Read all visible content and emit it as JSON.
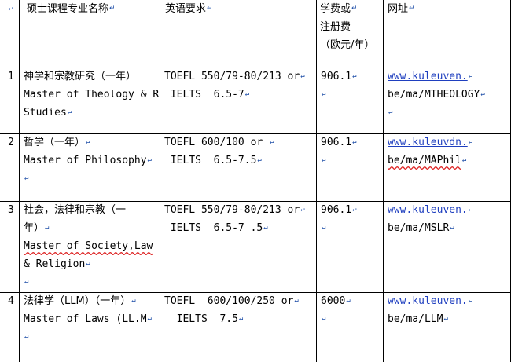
{
  "header": {
    "num": "",
    "program": "硕士课程专业名称",
    "english": "英语要求",
    "fee": [
      "学费或",
      "注册费",
      "（欧元/年）"
    ],
    "url": "网址"
  },
  "rows": [
    {
      "num": "1",
      "name_cn": "神学和宗教研究（一年）",
      "name_en": [
        "Master of Theology & Re",
        "Studies"
      ],
      "english": [
        "TOEFL 550/79-80/213 or",
        " IELTS  6.5-7"
      ],
      "fee": "906.1",
      "url": [
        "www.kuleuven.",
        "be/ma/MTHEOLOGY"
      ]
    },
    {
      "num": "2",
      "name_cn": "哲学（一年）",
      "name_en": [
        "Master of Philosophy"
      ],
      "english": [
        "TOEFL 600/100 or ",
        " IELTS  6.5-7.5"
      ],
      "fee": "906.1",
      "url": [
        "www.kuleuvdn.",
        "be/ma/MAPhil"
      ]
    },
    {
      "num": "3",
      "name_cn": [
        "社会，法律和宗教（一",
        "年）"
      ],
      "name_en": [
        "Master of Society,Law",
        "& Religion"
      ],
      "english": [
        "TOEFL 550/79-80/213 or",
        " IELTS  6.5-7 .5"
      ],
      "fee": "906.1",
      "url": [
        "www.kuleuven.",
        "be/ma/MSLR"
      ]
    },
    {
      "num": "4",
      "name_cn": "法律学（LLM）（一年）",
      "name_en": [
        "Master of Laws (LL.M"
      ],
      "english": [
        "TOEFL  600/100/250 or",
        "  IELTS  7.5"
      ],
      "fee": "6000",
      "url": [
        "www.kuleuven.",
        "be/ma/LLM"
      ]
    }
  ],
  "mark": "↵"
}
